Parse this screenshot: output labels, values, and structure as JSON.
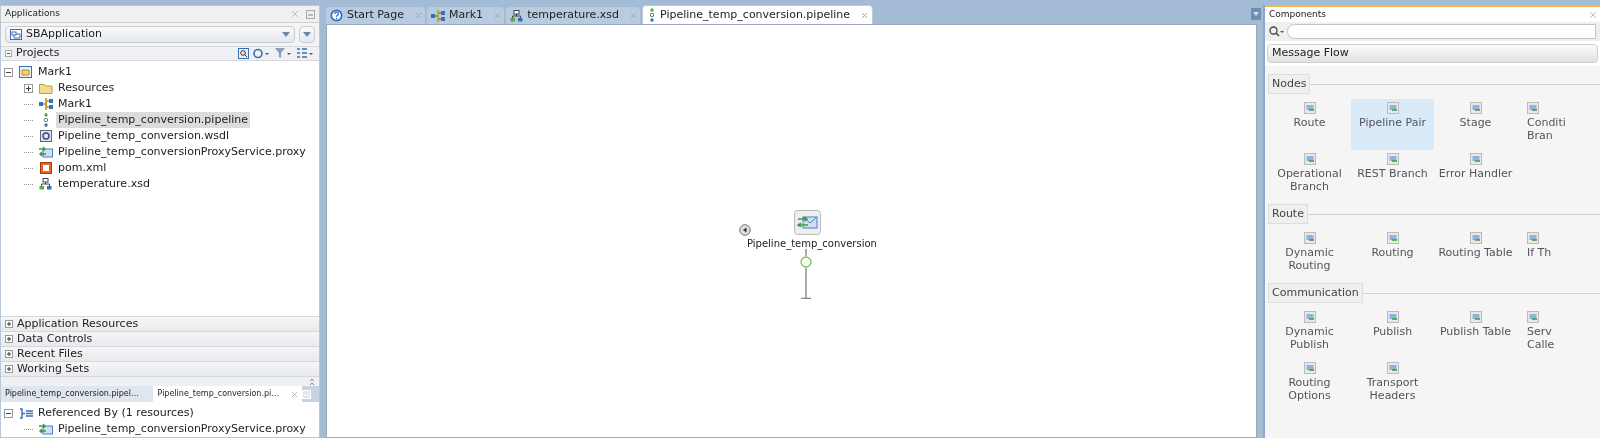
{
  "applications_panel": {
    "title": "Applications",
    "application": "SBApplication",
    "projects_title": "Projects",
    "tree": [
      {
        "label": "Mark1",
        "kind": "project",
        "expanded": true,
        "selected": false,
        "children": [
          {
            "label": "Resources",
            "kind": "folder",
            "expanded": false,
            "selected": false
          },
          {
            "label": "Mark1",
            "kind": "overview",
            "selected": false
          },
          {
            "label": "Pipeline_temp_conversion.pipeline",
            "kind": "pipeline",
            "selected": true
          },
          {
            "label": "Pipeline_temp_conversion.wsdl",
            "kind": "wsdl",
            "selected": false
          },
          {
            "label": "Pipeline_temp_conversionProxyService.proxy",
            "kind": "proxy",
            "selected": false
          },
          {
            "label": "pom.xml",
            "kind": "xml",
            "selected": false
          },
          {
            "label": "temperature.xsd",
            "kind": "xsd",
            "selected": false
          }
        ]
      }
    ],
    "accordions": [
      {
        "label": "Application Resources",
        "expanded": false
      },
      {
        "label": "Data Controls",
        "expanded": false
      },
      {
        "label": "Recent Files",
        "expanded": false
      },
      {
        "label": "Working Sets",
        "expanded": false
      }
    ]
  },
  "bottom_panel": {
    "tabs": [
      {
        "label": "Pipeline_temp_conversion.pipel…",
        "selected": false
      },
      {
        "label": "Pipeline_temp_conversion.pi…",
        "selected": true
      }
    ],
    "tree": [
      {
        "label": "Referenced By (1 resources)",
        "kind": "references",
        "expanded": true,
        "children": [
          {
            "label": "Pipeline_temp_conversionProxyService.proxy",
            "kind": "proxy"
          }
        ]
      }
    ]
  },
  "editor": {
    "tabs": [
      {
        "label": "Start Page",
        "kind": "help",
        "selected": false
      },
      {
        "label": "Mark1",
        "kind": "overview",
        "selected": false
      },
      {
        "label": "temperature.xsd",
        "kind": "xsd",
        "selected": false
      },
      {
        "label": "Pipeline_temp_conversion.pipeline",
        "kind": "pipeline",
        "selected": true
      }
    ],
    "canvas": {
      "node_label": "Pipeline_temp_conversion"
    }
  },
  "components": {
    "title": "Components",
    "palette": "Message Flow",
    "sections": [
      {
        "title": "Nodes",
        "items": [
          {
            "label": "Route",
            "selected": false
          },
          {
            "label": "Pipeline Pair",
            "selected": true
          },
          {
            "label": "Stage",
            "selected": false
          },
          {
            "label": "Conditi\nBran",
            "selected": false
          },
          {
            "label": "Operational\nBranch",
            "selected": false
          },
          {
            "label": "REST Branch",
            "selected": false
          },
          {
            "label": "Error Handler",
            "selected": false
          }
        ]
      },
      {
        "title": "Route",
        "items": [
          {
            "label": "Dynamic\nRouting",
            "selected": false
          },
          {
            "label": "Routing",
            "selected": false
          },
          {
            "label": "Routing Table",
            "selected": false
          },
          {
            "label": "If Th",
            "selected": false
          }
        ]
      },
      {
        "title": "Communication",
        "items": [
          {
            "label": "Dynamic\nPublish",
            "selected": false
          },
          {
            "label": "Publish",
            "selected": false
          },
          {
            "label": "Publish Table",
            "selected": false
          },
          {
            "label": "Serv\nCalle",
            "selected": false
          },
          {
            "label": "Routing\nOptions",
            "selected": false
          },
          {
            "label": "Transport\nHeaders",
            "selected": false
          }
        ]
      }
    ]
  }
}
